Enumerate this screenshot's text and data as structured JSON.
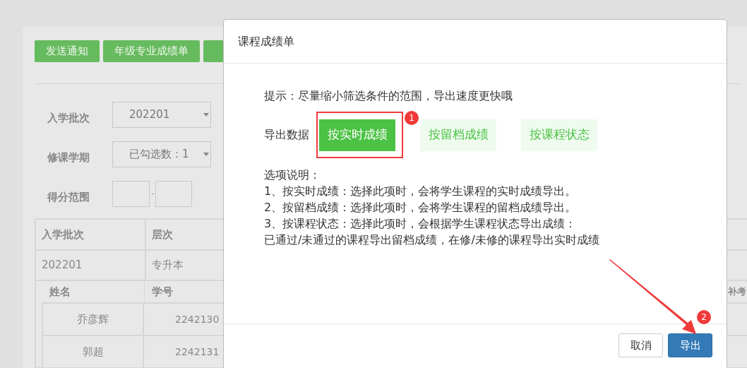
{
  "page": {
    "toolbar_buttons": [
      "发送通知",
      "年级专业成绩单"
    ],
    "filters": [
      {
        "label": "入学批次",
        "kind": "select",
        "value": "202201"
      },
      {
        "label": "修课学期",
        "kind": "select",
        "value": "已勾选数：1"
      },
      {
        "label": "得分范围",
        "kind": "range",
        "separator": "-"
      }
    ],
    "table": {
      "columns": [
        "入学批次",
        "层次"
      ],
      "rows": [
        [
          "202201",
          "专升本"
        ]
      ]
    },
    "sub_table": {
      "columns": [
        "姓名",
        "学号",
        "补考"
      ],
      "rows": [
        [
          "乔彦辉",
          "2242130"
        ],
        [
          "郭超",
          "2242131"
        ]
      ]
    }
  },
  "dialog": {
    "title": "课程成绩单",
    "hint": "提示：尽量缩小筛选条件的范围，导出速度更快哦",
    "export_label": "导出数据",
    "options": [
      {
        "label": "按实时成绩",
        "selected": true
      },
      {
        "label": "按留档成绩",
        "selected": false
      },
      {
        "label": "按课程状态",
        "selected": false
      }
    ],
    "notes": [
      "选项说明：",
      "1、按实时成绩：选择此项时，会将学生课程的实时成绩导出。",
      "2、按留档成绩：选择此项时，会将学生课程的留档成绩导出。",
      "3、按课程状态：选择此项时，会根据学生课程状态导出成绩：",
      "已通过/未通过的课程导出留档成绩，在修/未修的课程导出实时成绩"
    ],
    "buttons": [
      {
        "label": "取消",
        "kind": "default"
      },
      {
        "label": "导出",
        "kind": "primary"
      }
    ]
  },
  "annotations": [
    {
      "label": "1"
    },
    {
      "label": "2"
    }
  ]
}
